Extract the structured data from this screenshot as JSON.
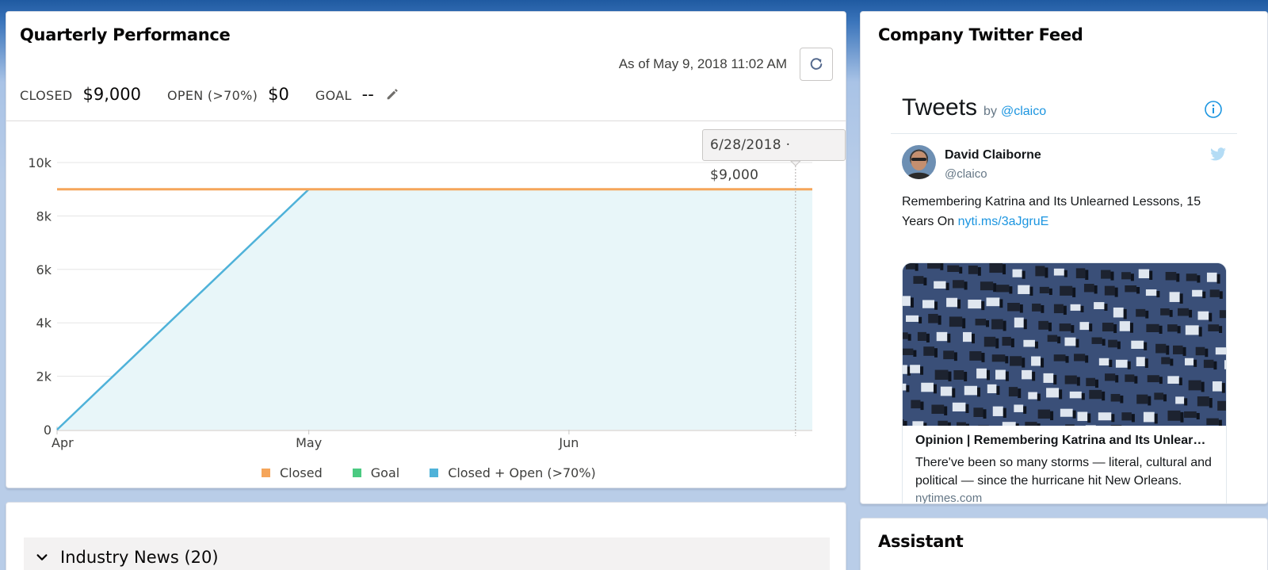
{
  "quarterly": {
    "title": "Quarterly Performance",
    "as_of": "As of May 9, 2018 11:02 AM",
    "metrics": {
      "closed_label": "CLOSED",
      "closed_value": "$9,000",
      "open_label": "OPEN (>70%)",
      "open_value": "$0",
      "goal_label": "GOAL",
      "goal_value": "--"
    },
    "tooltip": "6/28/2018 · $9,000",
    "legend": {
      "closed": "Closed",
      "goal": "Goal",
      "closed_open": "Closed + Open (>70%)"
    }
  },
  "chart_data": {
    "type": "area",
    "x_ticks": [
      "Apr",
      "May",
      "Jun"
    ],
    "y_ticks": [
      "0",
      "2k",
      "4k",
      "6k",
      "8k",
      "10k"
    ],
    "ylim": [
      0,
      10000
    ],
    "xlim": [
      "2018-04-01",
      "2018-06-30"
    ],
    "grid": true,
    "legend_position": "bottom",
    "series": [
      {
        "name": "Closed",
        "color": "#f5a55a",
        "points": [
          {
            "x": "2018-04-01",
            "y": 9000
          },
          {
            "x": "2018-06-30",
            "y": 9000
          }
        ]
      },
      {
        "name": "Goal",
        "color": "#4bca81",
        "points": []
      },
      {
        "name": "Closed + Open (>70%)",
        "color": "#4fb2d9",
        "fill": "#e8f6f9",
        "points": [
          {
            "x": "2018-04-01",
            "y": 0
          },
          {
            "x": "2018-05-01",
            "y": 9000
          },
          {
            "x": "2018-06-30",
            "y": 9000
          }
        ]
      }
    ],
    "highlight": {
      "x": "2018-06-28",
      "label": "6/28/2018 · $9,000"
    }
  },
  "news": {
    "title": "Industry News (20)"
  },
  "twitter": {
    "title": "Company Twitter Feed",
    "tweets_label": "Tweets",
    "by_label": "by",
    "handle": "@claico",
    "author_name": "David Claiborne",
    "author_handle": "@claico",
    "tweet_text": "Remembering Katrina and Its Unlearned Lessons, 15 Years On",
    "tweet_link": "nyti.ms/3aJgruE",
    "card_headline": "Opinion | Remembering Katrina and Its Unlear…",
    "card_description": "There've been so many storms — literal, cultural and political — since the hurricane hit New Orleans.",
    "card_domain": "nytimes.com"
  },
  "assistant": {
    "title": "Assistant"
  },
  "colors": {
    "closed": "#f5a55a",
    "goal": "#4bca81",
    "closed_open": "#4fb2d9",
    "area_fill": "#e8f6f9",
    "twitter_link": "#1b95e0"
  }
}
